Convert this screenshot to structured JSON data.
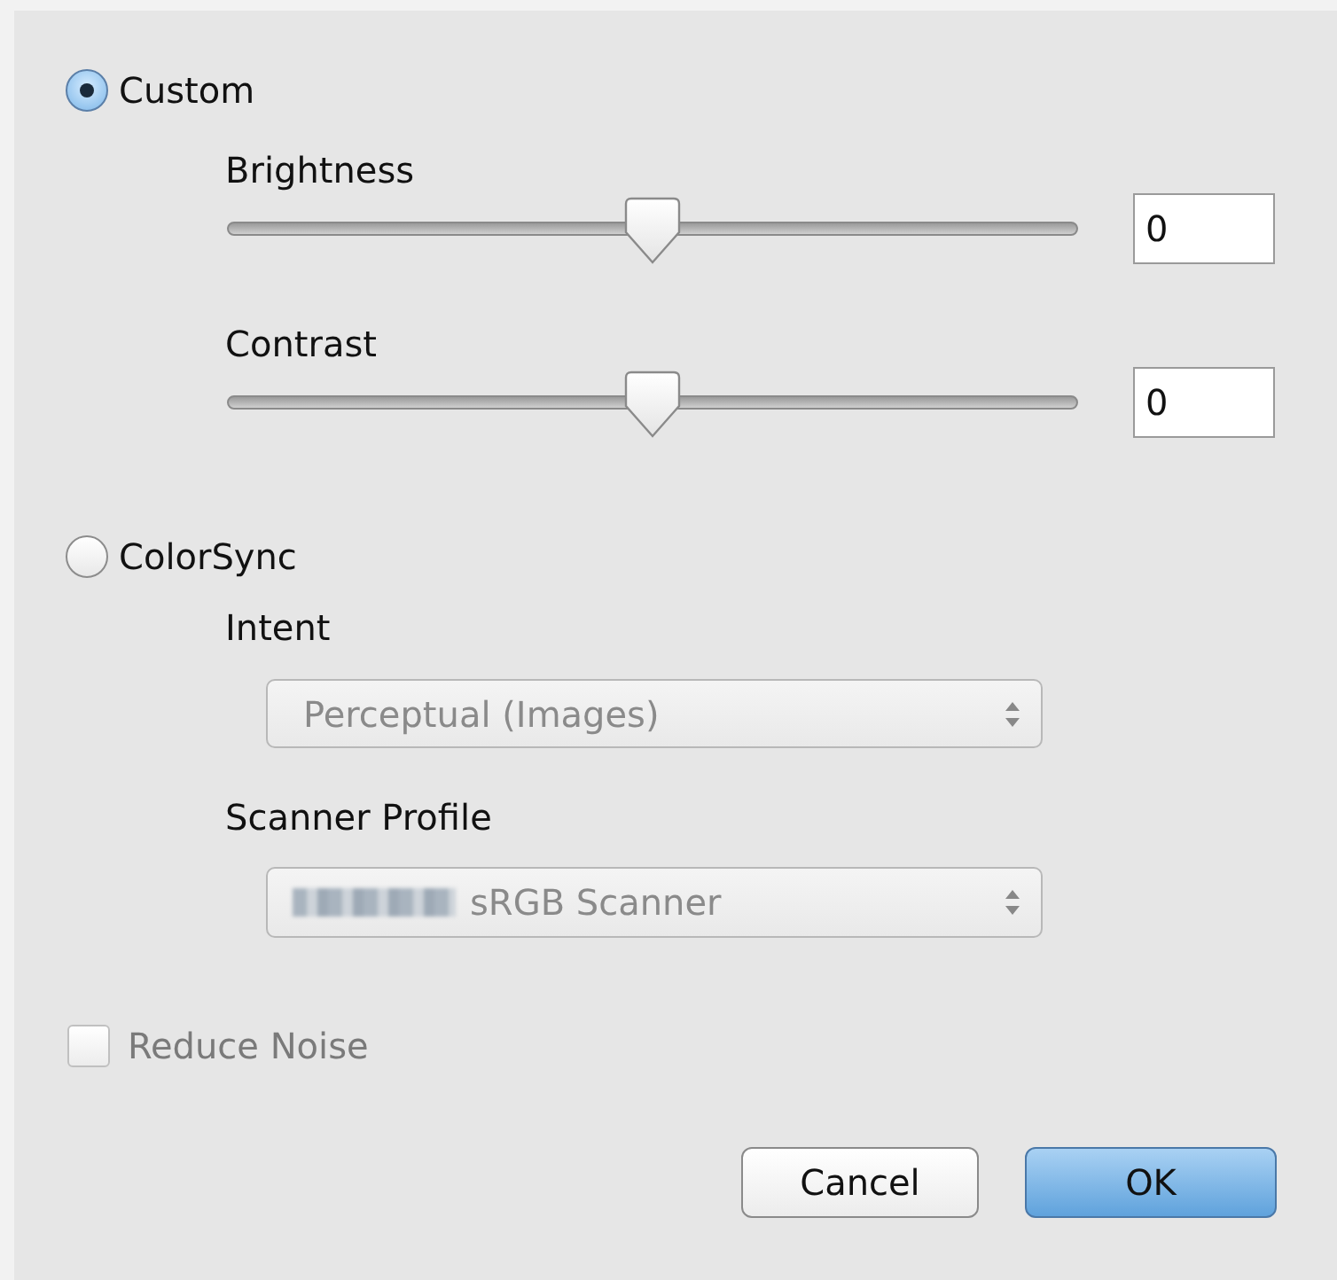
{
  "modes": [
    {
      "label": "Custom",
      "selected": true
    },
    {
      "label": "ColorSync",
      "selected": false
    }
  ],
  "custom": {
    "sliders": [
      {
        "label": "Brightness",
        "level": 0.5,
        "value": "0"
      },
      {
        "label": "Contrast",
        "level": 0.5,
        "value": "0"
      }
    ]
  },
  "colorsync": {
    "disabled": true,
    "popups": [
      {
        "label": "Intent",
        "value": "Perceptual (Images)",
        "redacted_prefix": false
      },
      {
        "label": "Scanner Profile",
        "value": "sRGB Scanner",
        "redacted_prefix": true
      }
    ]
  },
  "reduce_noise": {
    "label": "Reduce Noise",
    "checked": false,
    "disabled": true
  },
  "buttons": [
    {
      "label": "Cancel",
      "default": false
    },
    {
      "label": "OK",
      "default": true
    }
  ]
}
